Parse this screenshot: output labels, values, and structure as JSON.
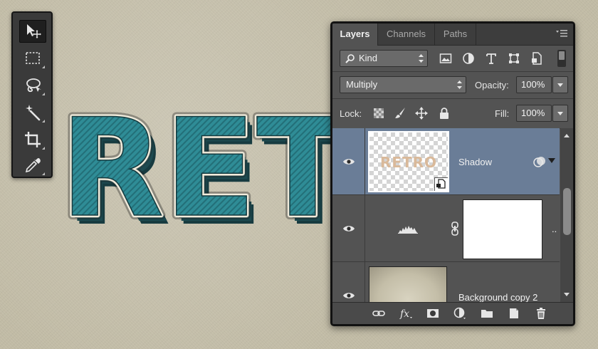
{
  "canvas": {
    "text": "RET",
    "text_fill": "#2f8c96",
    "text_outline": "#f1ecdc",
    "extrude": "#1f4f55"
  },
  "toolbox": {
    "tools": [
      {
        "icon": "move-icon",
        "active": true
      },
      {
        "icon": "marquee-icon",
        "active": false
      },
      {
        "icon": "lasso-icon",
        "active": false
      },
      {
        "icon": "magic-wand-icon",
        "active": false
      },
      {
        "icon": "crop-icon",
        "active": false
      },
      {
        "icon": "eyedropper-icon",
        "active": false
      }
    ]
  },
  "panel": {
    "tabs": [
      {
        "label": "Layers",
        "active": true
      },
      {
        "label": "Channels",
        "active": false
      },
      {
        "label": "Paths",
        "active": false
      }
    ],
    "filter": {
      "kind_label": "Kind"
    },
    "blend": {
      "mode": "Multiply",
      "opacity_label": "Opacity:",
      "opacity_value": "100%"
    },
    "lock": {
      "lock_label": "Lock:",
      "fill_label": "Fill:",
      "fill_value": "100%"
    },
    "layers": [
      {
        "name": "Shadow",
        "selected": true,
        "thumb_text": "RETRO"
      },
      {
        "name": "",
        "selected": false,
        "ellipsis": ".."
      },
      {
        "name": "Background copy 2",
        "selected": false
      }
    ],
    "colors": {
      "panel_bg": "#535353",
      "selected_layer": "#6a7d97",
      "tab_bar": "#3d3d3d"
    }
  }
}
